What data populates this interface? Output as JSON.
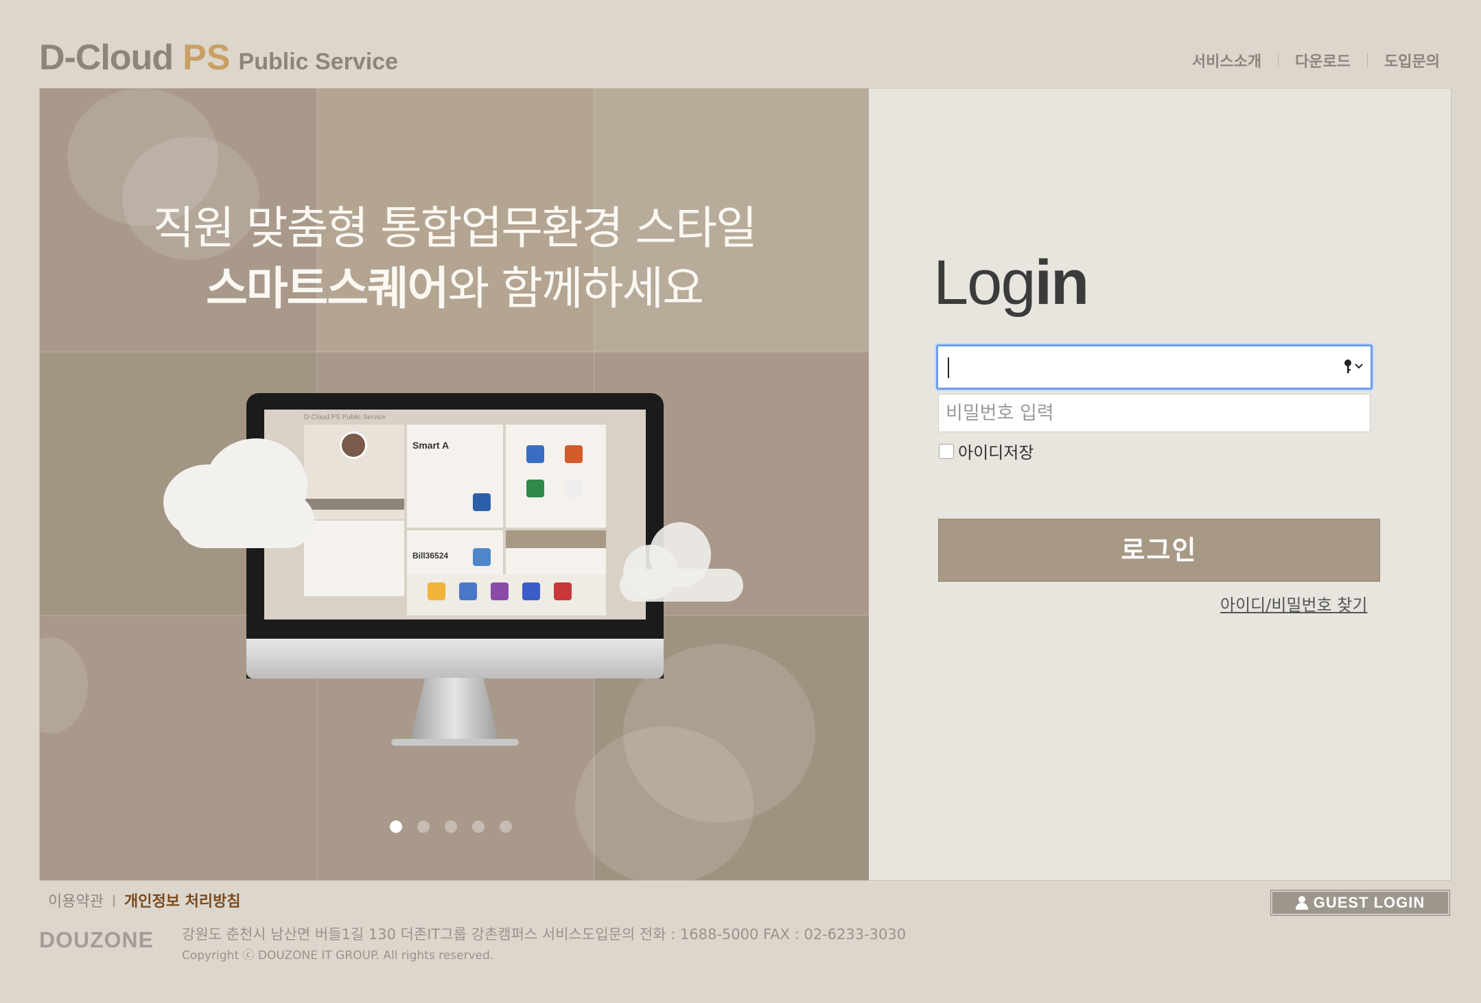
{
  "header": {
    "logo_main": "D-Cloud",
    "logo_ps": "PS",
    "logo_sub": "Public Service",
    "nav": [
      "서비스소개",
      "다운로드",
      "도입문의"
    ]
  },
  "banner": {
    "headline_line1": "직원 맞춤형 통합업무환경 스타일",
    "headline_bold": "스마트스퀘어",
    "headline_rest": "와 함께하세요",
    "slides_count": 5,
    "active_slide": 1,
    "screen_logo": "D-Cloud PS Public Service",
    "screen_smart_title": "Smart A",
    "screen_bill": "Bill36524"
  },
  "login": {
    "title_light": "Log",
    "title_bold": "in",
    "id_value": "",
    "password_placeholder": "비밀번호 입력",
    "remember_label": "아이디저장",
    "remember_checked": false,
    "login_button": "로그인",
    "find_link": "아이디/비밀번호 찾기"
  },
  "footer": {
    "terms": "이용약관",
    "separator": "|",
    "privacy": "개인정보 처리방침",
    "brand": "DOUZONE",
    "address": "강원도 춘천시 남산면 버들1길 130 더존IT그룹 강촌캠퍼스   서비스도입문의 전화 : 1688-5000   FAX : 02-6233-3030",
    "copyright": "Copyright ⓒ DOUZONE IT GROUP. All rights reserved.",
    "guest_login": "GUEST LOGIN"
  },
  "colors": {
    "accent_ps": "#c9a063",
    "login_button": "#a79985",
    "banner_bg": "#a8998a",
    "privacy_link": "#7a4a1c",
    "focus_border": "#6f9ee6"
  },
  "icons": [
    "key-icon",
    "chevron-down-icon",
    "person-icon"
  ]
}
